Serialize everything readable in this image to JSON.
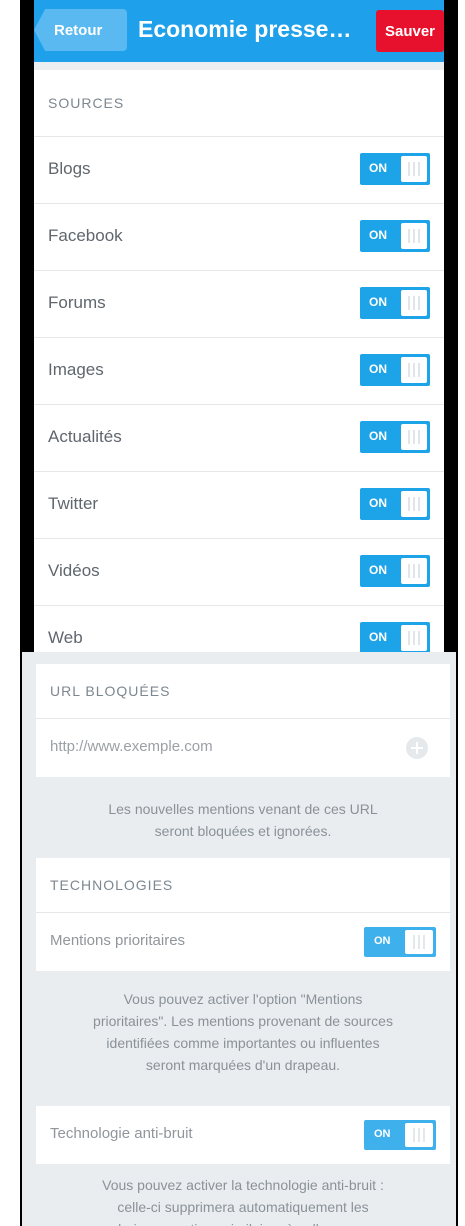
{
  "nav": {
    "back_label": "Retour",
    "title": "Economie presse…",
    "save_label": "Sauver"
  },
  "sources": {
    "header": "SOURCES",
    "items": [
      {
        "label": "Blogs",
        "state": "ON"
      },
      {
        "label": "Facebook",
        "state": "ON"
      },
      {
        "label": "Forums",
        "state": "ON"
      },
      {
        "label": "Images",
        "state": "ON"
      },
      {
        "label": "Actualités",
        "state": "ON"
      },
      {
        "label": "Twitter",
        "state": "ON"
      },
      {
        "label": "Vidéos",
        "state": "ON"
      },
      {
        "label": "Web",
        "state": "ON"
      }
    ]
  },
  "blocked_urls": {
    "header": "URL BLOQUÉES",
    "placeholder": "http://www.exemple.com",
    "note_line1": "Les nouvelles mentions venant de ces URL",
    "note_line2": "seront bloquées et ignorées."
  },
  "technologies": {
    "header": "TECHNOLOGIES",
    "priority_label": "Mentions prioritaires",
    "priority_state": "ON",
    "priority_note": [
      "Vous pouvez activer l'option \"Mentions",
      "prioritaires\". Les mentions provenant de sources",
      "identifiées comme importantes ou influentes",
      "seront marquées d'un drapeau."
    ],
    "antinoise_label": "Technologie anti-bruit",
    "antinoise_state": "ON",
    "antinoise_note": [
      "Vous pouvez activer la technologie anti-bruit :",
      "celle-ci supprimera automatiquement les",
      "prochaines mentions similaires à celles-que vous"
    ]
  },
  "colors": {
    "nav_bar": "#1fa0ea",
    "save_button": "#e8112d",
    "toggle_on": "#1da3e8"
  }
}
